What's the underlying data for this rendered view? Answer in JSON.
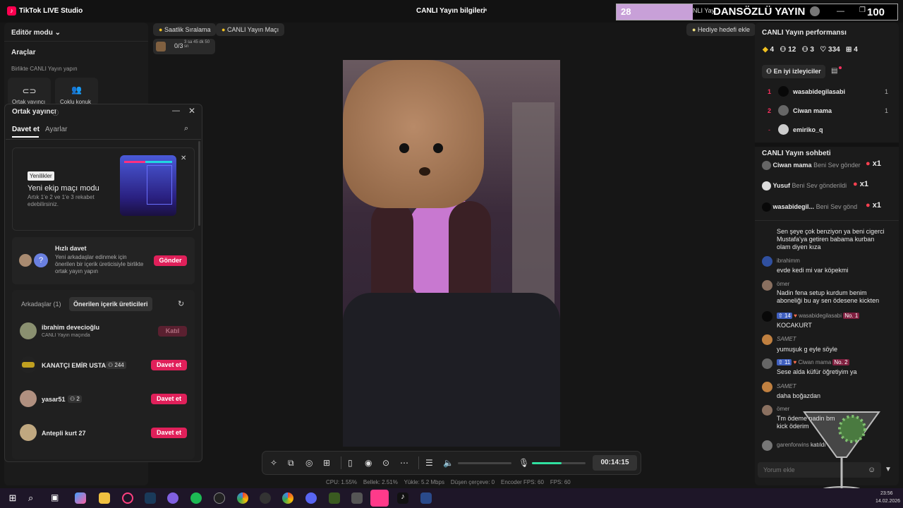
{
  "app": {
    "title": "TikTok LIVE Studio",
    "center_title": "CANLI Yayın bilgileri"
  },
  "overlay": {
    "count": "28",
    "marquee": "NLI Yay",
    "banner": "DANSÖZLÜ YAYIN",
    "score": "100"
  },
  "left": {
    "mode": "Editör modu",
    "tools_title": "Araçlar",
    "together_label": "Birlikte CANLI Yayın yapın",
    "tool1": "Ortak yayıncı",
    "tool2": "Çoklu konuk"
  },
  "dialog": {
    "title": "Ortak yayıncı",
    "tab_invite": "Davet et",
    "tab_settings": "Ayarlar",
    "promo": {
      "badge": "Yenilikler",
      "title": "Yeni ekip maçı modu",
      "desc": "Artık 1'e 2 ve 1'e 3 rekabet edebilirsiniz."
    },
    "quick": {
      "title": "Hızlı davet",
      "desc": "Yeni arkadaşlar edinmek için önerilen bir içerik üreticisiyle birlikte ortak yayın yapın",
      "button": "Gönder"
    },
    "tabs2": {
      "friends": "Arkadaşlar (1)",
      "suggested": "Önerilen içerik üreticileri"
    },
    "people": [
      {
        "name": "ibrahim devecioğlu",
        "sub": "CANLI Yayın maçında",
        "badge": "",
        "button": "Katıl"
      },
      {
        "name": "KANATÇI EMİR USTA",
        "sub": "",
        "badge": "244",
        "button": "Davet et"
      },
      {
        "name": "yasar51",
        "sub": "",
        "badge": "2",
        "button": "Davet et"
      },
      {
        "name": "Antepli kurt 27",
        "sub": "",
        "badge": "",
        "button": "Davet et"
      }
    ]
  },
  "top_pills": {
    "hourly": "Saatlik Sıralama",
    "match": "CANLI Yayın Maçı",
    "gift_goal": "Hediye hedefi ekle",
    "goal_progress": "0/3",
    "goal_timer": "3 sa 45 dk 50 sn"
  },
  "right": {
    "perf_title": "CANLI Yayın performansı",
    "stats": [
      "4",
      "12",
      "3",
      "334",
      "4"
    ],
    "top_viewers_btn": "En iyi izleyiciler",
    "viewers": [
      {
        "rank": "1",
        "name": "wasabidegilasabi",
        "count": "1"
      },
      {
        "rank": "2",
        "name": "Ciwan mama",
        "count": "1"
      },
      {
        "rank": "-",
        "name": "emiriko_q",
        "count": ""
      }
    ],
    "chat_title": "CANLI Yayın sohbeti",
    "gifts": [
      {
        "name": "Ciwan mama",
        "text": "Beni Sev gönder",
        "mult": "x1"
      },
      {
        "name": "Yusuf",
        "text": "Beni Sev gönderildi",
        "mult": "x1"
      },
      {
        "name": "wasabidegil...",
        "text": "Beni Sev gönd",
        "mult": "x1"
      }
    ],
    "messages": [
      {
        "user": "",
        "text": "Sen şeye çok benziyon ya beni cigerci Mustafa'ya getiren babama kurban olam diyen kıza"
      },
      {
        "user": "ibrahimm",
        "text": "evde kedi mi var köpekmi"
      },
      {
        "user": "ömer",
        "text": "Nadin fena setup kurdum benim aboneliği bu ay sen ödesene kickten"
      },
      {
        "user": "wasabidegilasabi",
        "text": "KOCAKURT",
        "lvl": "14",
        "no": "No. 1"
      },
      {
        "user": "SAMET",
        "text": "yumuşuk g eyle söyle"
      },
      {
        "user": "Ciwan mama",
        "text": "Sese alda küfür öğretiyim ya",
        "lvl": "11",
        "no": "No. 2"
      },
      {
        "user": "SAMET",
        "text": "daha boğazdan"
      },
      {
        "user": "ömer",
        "text": "Tm ödeme nadin bm kick öderim"
      },
      {
        "user": "garenforwins",
        "text": "katıldı"
      }
    ],
    "comment_placeholder": "Yorum ekle"
  },
  "controls": {
    "timer": "00:14:15",
    "volume_level": 0.55
  },
  "stats_bar": {
    "cpu": "CPU: 1.55%",
    "mem": "Bellek: 2.51%",
    "upload": "Yükle: 5.2 Mbps",
    "dropped": "Düşen çerçeve: 0",
    "encoder": "Encoder FPS: 60",
    "fps": "FPS: 60"
  },
  "taskbar": {
    "time": "23:56",
    "date": "14.02.2026"
  }
}
